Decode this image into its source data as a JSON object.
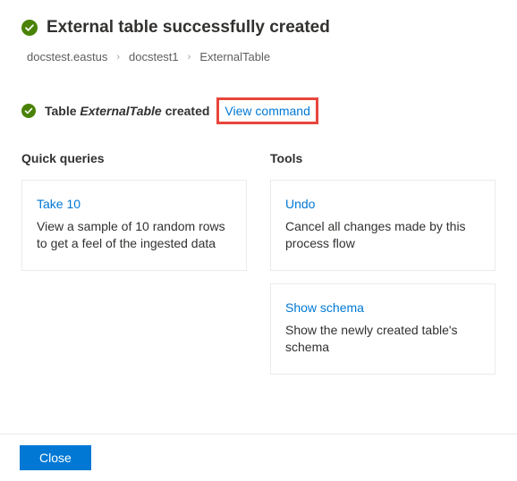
{
  "header": {
    "title": "External table successfully created"
  },
  "breadcrumb": {
    "items": [
      "docstest.eastus",
      "docstest1",
      "ExternalTable"
    ]
  },
  "status": {
    "prefix": "Table ",
    "tableName": "ExternalTable",
    "suffix": " created",
    "viewCommandLabel": "View command"
  },
  "quickQueries": {
    "heading": "Quick queries",
    "cards": [
      {
        "title": "Take 10",
        "desc": "View a sample of 10 random rows to get a feel of the ingested data"
      }
    ]
  },
  "tools": {
    "heading": "Tools",
    "cards": [
      {
        "title": "Undo",
        "desc": "Cancel all changes made by this process flow"
      },
      {
        "title": "Show schema",
        "desc": "Show the newly created table's schema"
      }
    ]
  },
  "footer": {
    "closeLabel": "Close"
  },
  "colors": {
    "accent": "#0078d4",
    "success": "#498205",
    "highlightBorder": "#e8453c"
  }
}
